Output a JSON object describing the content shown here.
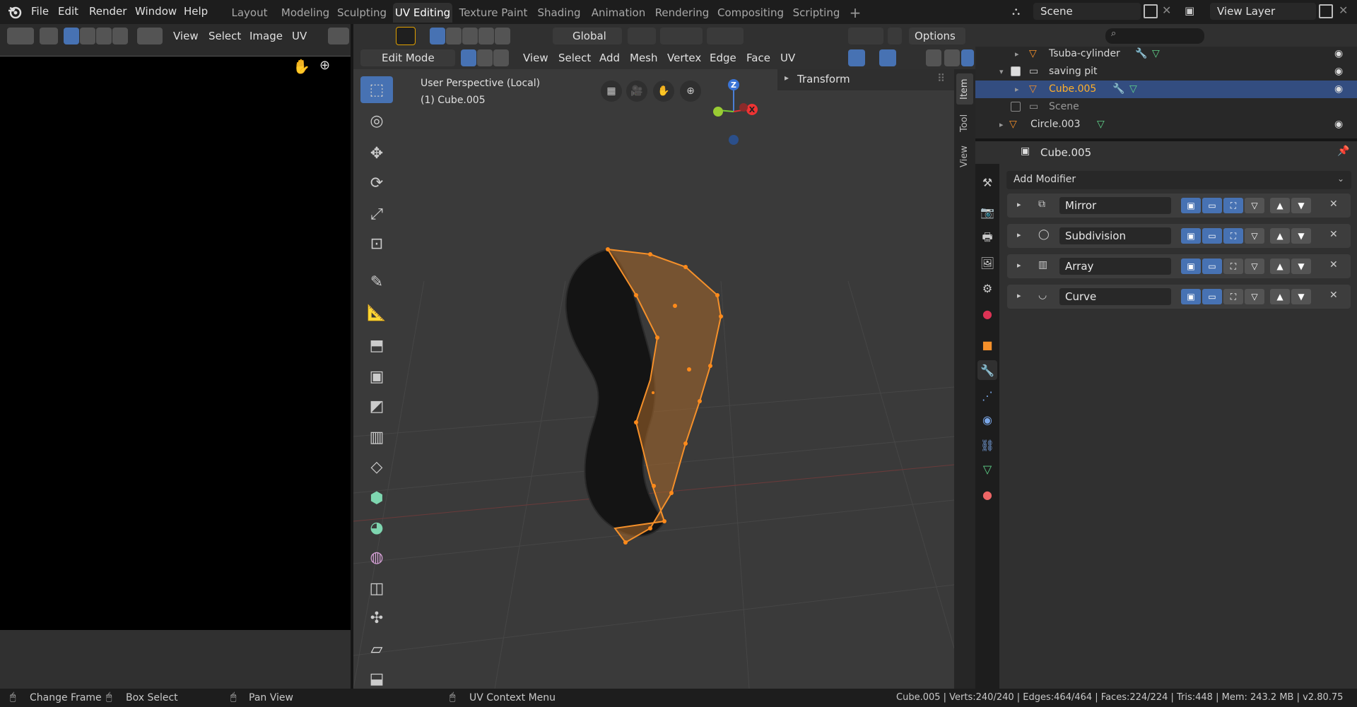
{
  "menu": {
    "file": "File",
    "edit": "Edit",
    "render": "Render",
    "window": "Window",
    "help": "Help"
  },
  "workspaces": [
    "Layout",
    "Modeling",
    "Sculpting",
    "UV Editing",
    "Texture Paint",
    "Shading",
    "Animation",
    "Rendering",
    "Compositing",
    "Scripting"
  ],
  "active_workspace": "UV Editing",
  "scene": "Scene",
  "view_layer": "View Layer",
  "uv_editor": {
    "menus": [
      "View",
      "Select",
      "Image",
      "UV"
    ]
  },
  "viewport": {
    "orientation": "Global",
    "options": "Options",
    "mode": "Edit Mode",
    "menus": [
      "View",
      "Select",
      "Add",
      "Mesh",
      "Vertex",
      "Edge",
      "Face",
      "UV"
    ],
    "perspective": "User Perspective (Local)",
    "object_info": "(1) Cube.005",
    "n_panel_title": "Transform",
    "side_tabs": [
      "Item",
      "Tool",
      "View"
    ],
    "gizmo": {
      "z": "Z",
      "x": "X"
    }
  },
  "outliner": {
    "rows": [
      {
        "name": "Tsuba-cylinder",
        "selected": false
      },
      {
        "name": "saving pit",
        "selected": false
      },
      {
        "name": "Cube.005",
        "selected": true
      },
      {
        "name": "Scene",
        "selected": false
      },
      {
        "name": "Circle.003",
        "selected": false
      }
    ]
  },
  "properties": {
    "object": "Cube.005",
    "add_modifier": "Add Modifier",
    "modifiers": [
      "Mirror",
      "Subdivision",
      "Array",
      "Curve"
    ]
  },
  "status_bar": {
    "change_frame": "Change Frame",
    "box_select": "Box Select",
    "pan_view": "Pan View",
    "uv_context": "UV Context Menu",
    "stats": "Cube.005 | Verts:240/240 | Edges:464/464 | Faces:224/224 | Tris:448 | Mem: 243.2 MB | v2.80.75"
  },
  "colors": {
    "accent": "#4772b3",
    "selected_orange": "#f5902a",
    "header": "#1d1d1d",
    "panel": "#303030"
  }
}
